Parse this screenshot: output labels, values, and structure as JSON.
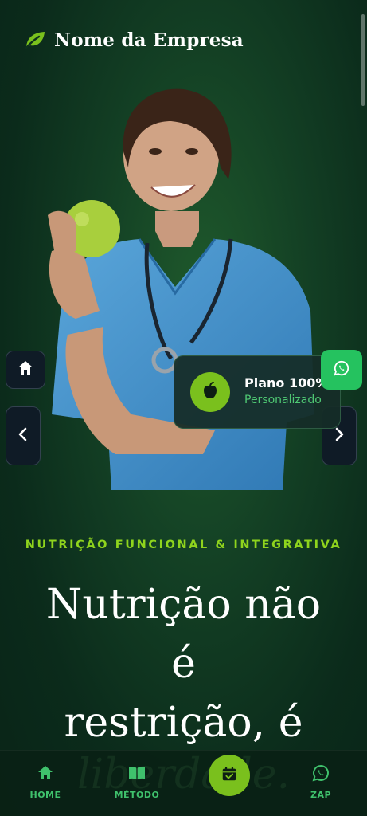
{
  "header": {
    "brand_name": "Nome da Empresa",
    "logo_icon": "leaf-icon"
  },
  "plan_card": {
    "title": "Plano 100%",
    "subtitle": "Personalizado",
    "icon": "apple-icon"
  },
  "hero": {
    "tagline": "NUTRIÇÃO FUNCIONAL & INTEGRATIVA",
    "headline": "Nutrição não\né\nrestrição, é",
    "background_word": "liberdade."
  },
  "side_controls": {
    "home_icon": "home-icon",
    "prev_icon": "chevron-left-icon",
    "next_icon": "chevron-right-icon"
  },
  "floating_whatsapp": {
    "icon": "whatsapp-icon"
  },
  "bottom_nav": {
    "items": [
      {
        "label": "HOME",
        "icon": "home-icon"
      },
      {
        "label": "MÉTODO",
        "icon": "book-icon"
      },
      {
        "label": "",
        "icon": "calendar-check-icon"
      },
      {
        "label": "ZAP",
        "icon": "whatsapp-icon"
      }
    ]
  },
  "colors": {
    "accent_green": "#7ac01d",
    "label_green": "#3fc16c",
    "whatsapp_green": "#25c25f",
    "background": "#0c2f1d"
  }
}
